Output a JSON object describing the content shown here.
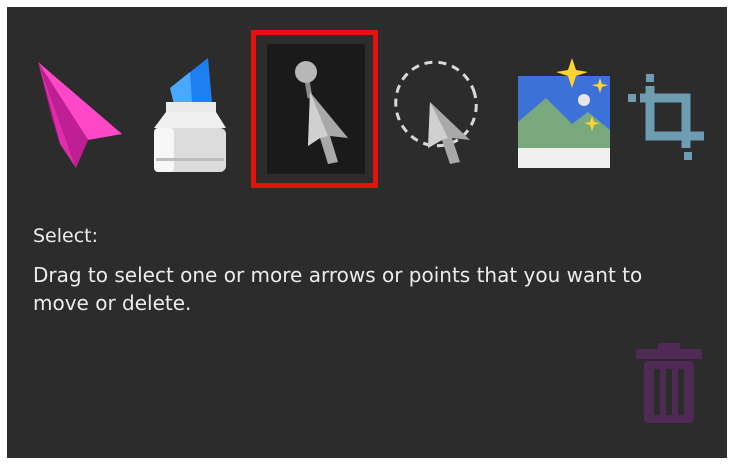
{
  "toolbar": {
    "tools": [
      {
        "name": "paper-plane-icon",
        "label": "Send"
      },
      {
        "name": "highlighter-icon",
        "label": "Highlight"
      },
      {
        "name": "select-arrow-icon",
        "label": "Select",
        "selected": true
      },
      {
        "name": "lasso-select-icon",
        "label": "Lasso select"
      },
      {
        "name": "image-icon",
        "label": "Insert image"
      },
      {
        "name": "crop-icon",
        "label": "Crop"
      }
    ],
    "selected_frame_color": "#e2120f"
  },
  "description": {
    "title": "Select:",
    "body": "Drag to select one or more arrows or points that you want to move or delete."
  },
  "trash": {
    "icon": "trash-icon",
    "color": "#4f2a55"
  }
}
